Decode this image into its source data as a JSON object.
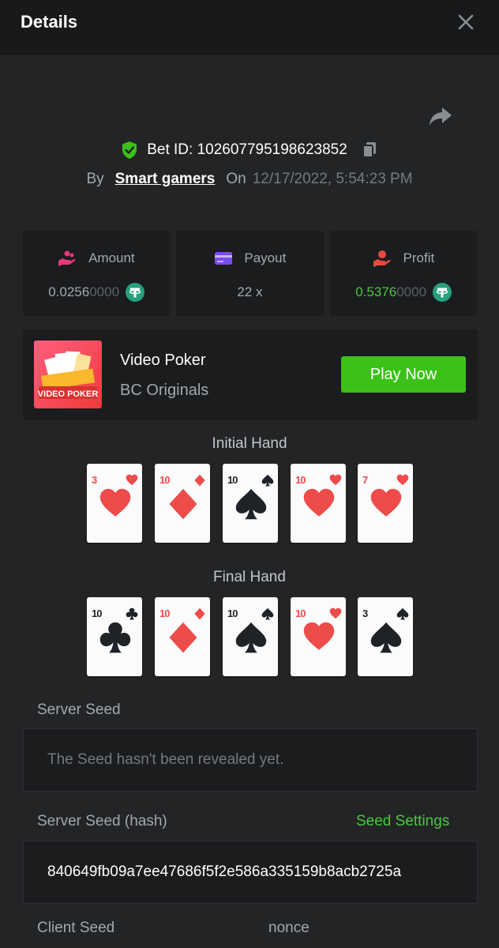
{
  "header": {
    "title": "Details"
  },
  "bet": {
    "id_label": "Bet ID: 102607795198623852",
    "by_label": "By",
    "user": "Smart gamers",
    "on_label": "On",
    "datetime": "12/17/2022, 5:54:23 PM"
  },
  "stats": {
    "amount": {
      "label": "Amount",
      "value_main": "0.0256",
      "value_dim": "0000",
      "icon": "hand-coins-icon",
      "currency_icon": "tether-icon"
    },
    "payout": {
      "label": "Payout",
      "value": "22 x",
      "icon": "card-icon"
    },
    "profit": {
      "label": "Profit",
      "value_main": "0.5376",
      "value_dim": "0000",
      "icon": "hand-coin-icon",
      "currency_icon": "tether-icon"
    }
  },
  "game": {
    "name": "Video Poker",
    "provider": "BC Originals",
    "thumb_label": "VIDEO POKER",
    "play_label": "Play Now"
  },
  "hands": {
    "initial": {
      "title": "Initial Hand",
      "cards": [
        {
          "rank": "3",
          "suit": "hearts"
        },
        {
          "rank": "10",
          "suit": "diamonds"
        },
        {
          "rank": "10",
          "suit": "spades"
        },
        {
          "rank": "10",
          "suit": "hearts"
        },
        {
          "rank": "7",
          "suit": "hearts"
        }
      ]
    },
    "final": {
      "title": "Final Hand",
      "cards": [
        {
          "rank": "10",
          "suit": "clubs"
        },
        {
          "rank": "10",
          "suit": "diamonds"
        },
        {
          "rank": "10",
          "suit": "spades"
        },
        {
          "rank": "10",
          "suit": "hearts"
        },
        {
          "rank": "3",
          "suit": "spades"
        }
      ]
    }
  },
  "seeds": {
    "server_seed_label": "Server Seed",
    "server_seed_value": "The Seed hasn't been revealed yet.",
    "server_hash_label": "Server Seed (hash)",
    "seed_settings_label": "Seed Settings",
    "server_hash_value": "840649fb09a7ee47686f5f2e586a335159b8acb2725a",
    "client_seed_label": "Client Seed",
    "nonce_label": "nonce"
  },
  "colors": {
    "accent_green": "#3bc117",
    "profit_green": "#48c93e",
    "red_suit": "#ee4b4b",
    "black_suit": "#1f2227"
  }
}
